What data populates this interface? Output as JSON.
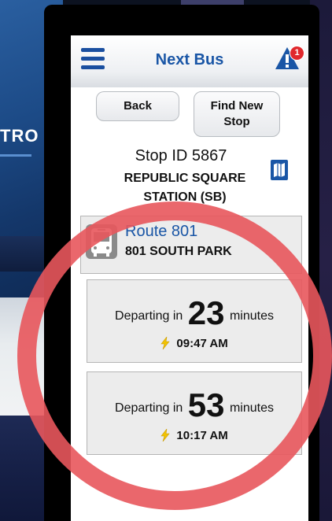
{
  "background": {
    "logo_text": "TRO"
  },
  "header": {
    "title": "Next Bus",
    "alert_count": "1"
  },
  "buttons": {
    "back": "Back",
    "find_new_stop_line1": "Find New",
    "find_new_stop_line2": "Stop"
  },
  "stop": {
    "id_label": "Stop ID 5867",
    "name_line1": "REPUBLIC SQUARE",
    "name_line2": "STATION (SB)"
  },
  "route": {
    "name": "Route 801",
    "destination": "801 SOUTH PARK"
  },
  "departures": [
    {
      "prefix": "Departing in",
      "minutes": "23",
      "suffix": "minutes",
      "time": "09:47 AM"
    },
    {
      "prefix": "Departing in",
      "minutes": "53",
      "suffix": "minutes",
      "time": "10:17 AM"
    }
  ],
  "colors": {
    "brand_blue": "#1a56a6",
    "alert_red": "#e0282c",
    "annotation_ring": "#e8575c"
  }
}
